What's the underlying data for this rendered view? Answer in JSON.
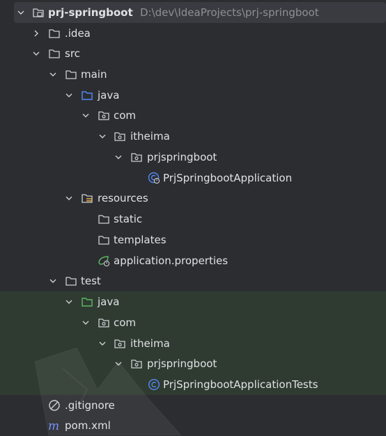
{
  "project": {
    "root_name": "prj-springboot",
    "root_path": "D:\\dev\\IdeaProjects\\prj-springboot"
  },
  "nodes": {
    "idea": ".idea",
    "src": "src",
    "main": "main",
    "main_java": "java",
    "main_com": "com",
    "main_itheima": "itheima",
    "main_prjspringboot": "prjspringboot",
    "main_app": "PrjSpringbootApplication",
    "resources": "resources",
    "static": "static",
    "templates": "templates",
    "app_props": "application.properties",
    "test": "test",
    "test_java": "java",
    "test_com": "com",
    "test_itheima": "itheima",
    "test_prjspringboot": "prjspringboot",
    "test_app": "PrjSpringbootApplicationTests",
    "gitignore": ".gitignore",
    "pom": "pom.xml"
  },
  "colors": {
    "background": "#2b2d30",
    "selected_row": "#393b40",
    "test_highlight": "#2f3b31",
    "source_folder_blue": "#548af7",
    "test_folder_green": "#5fb865",
    "class_icon_blue": "#548af7",
    "spring_green": "#5fb865",
    "maven_blue": "#6f8cff"
  },
  "icons": {
    "chevron_down": "chevron-down-icon",
    "chevron_right": "chevron-right-icon",
    "folder": "folder-icon",
    "package": "package-icon",
    "class": "class-icon",
    "resources": "resources-folder-icon",
    "spring": "spring-properties-icon",
    "ignore": "gitignore-icon",
    "maven": "maven-icon"
  }
}
